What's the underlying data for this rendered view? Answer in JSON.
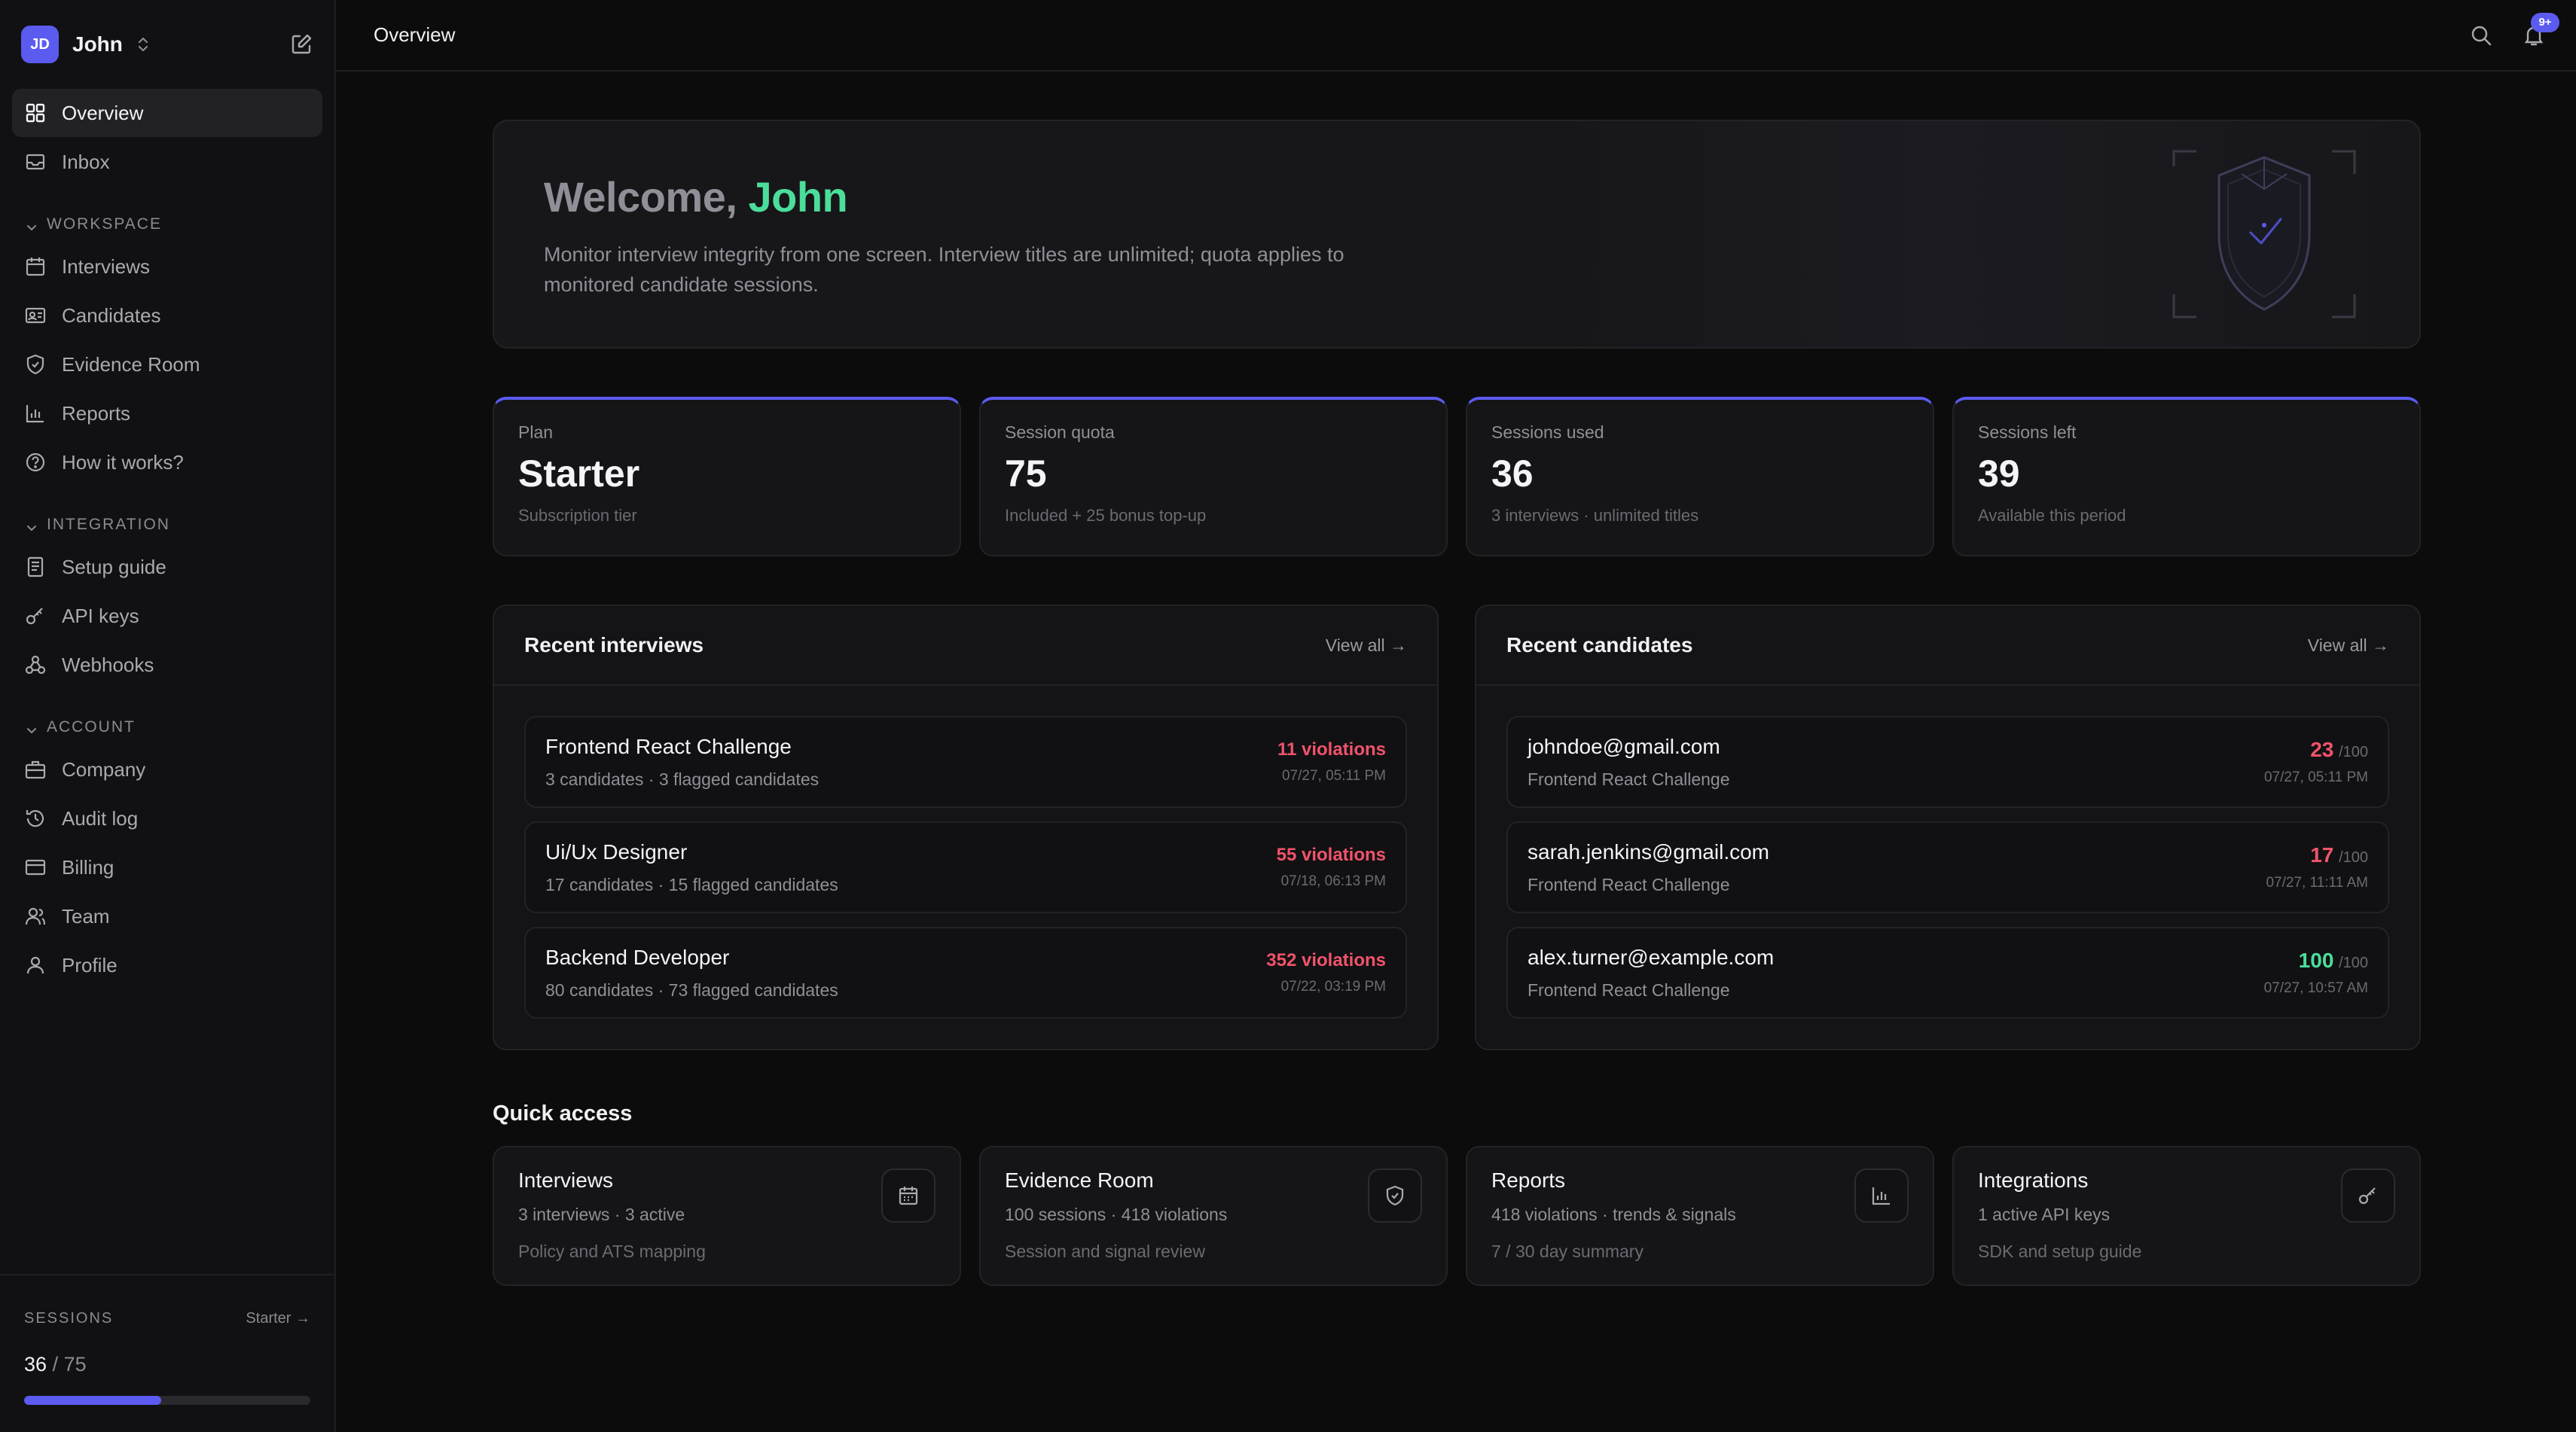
{
  "user": {
    "initials": "JD",
    "name": "John"
  },
  "nav": {
    "top": [
      {
        "label": "Overview",
        "icon": "grid-icon",
        "active": true
      },
      {
        "label": "Inbox",
        "icon": "inbox-icon"
      }
    ],
    "sections": [
      {
        "title": "WORKSPACE",
        "items": [
          {
            "label": "Interviews",
            "icon": "calendar-icon"
          },
          {
            "label": "Candidates",
            "icon": "id-card-icon"
          },
          {
            "label": "Evidence Room",
            "icon": "shield-icon"
          },
          {
            "label": "Reports",
            "icon": "bar-chart-icon"
          },
          {
            "label": "How it works?",
            "icon": "help-circle-icon"
          }
        ]
      },
      {
        "title": "INTEGRATION",
        "items": [
          {
            "label": "Setup guide",
            "icon": "document-icon"
          },
          {
            "label": "API keys",
            "icon": "key-icon"
          },
          {
            "label": "Webhooks",
            "icon": "webhook-icon"
          }
        ]
      },
      {
        "title": "ACCOUNT",
        "items": [
          {
            "label": "Company",
            "icon": "briefcase-icon"
          },
          {
            "label": "Audit log",
            "icon": "history-icon"
          },
          {
            "label": "Billing",
            "icon": "credit-card-icon"
          },
          {
            "label": "Team",
            "icon": "users-icon"
          },
          {
            "label": "Profile",
            "icon": "user-icon"
          }
        ]
      }
    ]
  },
  "sidebar_footer": {
    "label": "SESSIONS",
    "plan_link": "Starter →",
    "used": "36",
    "separator": "/",
    "total": "75",
    "progress_fraction": 0.48
  },
  "topbar": {
    "title": "Overview",
    "notification_badge": "9+"
  },
  "welcome": {
    "greeting": "Welcome,",
    "name": "John",
    "description": "Monitor interview integrity from one screen. Interview titles are unlimited; quota applies to monitored candidate sessions."
  },
  "stats": [
    {
      "label": "Plan",
      "value": "Starter",
      "sub": "Subscription tier"
    },
    {
      "label": "Session quota",
      "value": "75",
      "sub": "Included + 25 bonus top-up"
    },
    {
      "label": "Sessions used",
      "value": "36",
      "sub": "3 interviews · unlimited titles"
    },
    {
      "label": "Sessions left",
      "value": "39",
      "sub": "Available this period"
    }
  ],
  "recent_interviews": {
    "title": "Recent interviews",
    "view_all": "View all →",
    "rows": [
      {
        "title": "Frontend React Challenge",
        "sub": "3 candidates · 3 flagged candidates",
        "metric": "11 violations",
        "date": "07/27, 05:11 PM"
      },
      {
        "title": "Ui/Ux Designer",
        "sub": "17 candidates · 15 flagged candidates",
        "metric": "55 violations",
        "date": "07/18, 06:13 PM"
      },
      {
        "title": "Backend Developer",
        "sub": "80 candidates · 73 flagged candidates",
        "metric": "352 violations",
        "date": "07/22, 03:19 PM"
      }
    ]
  },
  "recent_candidates": {
    "title": "Recent candidates",
    "view_all": "View all →",
    "rows": [
      {
        "email": "johndoe@gmail.com",
        "interview": "Frontend React Challenge",
        "score": "23",
        "max": "/100",
        "date": "07/27, 05:11 PM"
      },
      {
        "email": "sarah.jenkins@gmail.com",
        "interview": "Frontend React Challenge",
        "score": "17",
        "max": "/100",
        "date": "07/27, 11:11 AM"
      },
      {
        "email": "alex.turner@example.com",
        "interview": "Frontend React Challenge",
        "score": "100",
        "max": "/100",
        "date": "07/27, 10:57 AM"
      }
    ]
  },
  "quick_access": {
    "title": "Quick access",
    "cards": [
      {
        "name": "Interviews",
        "line1": "3 interviews · 3 active",
        "line2": "Policy and ATS mapping",
        "icon": "calendar-icon"
      },
      {
        "name": "Evidence Room",
        "line1": "100 sessions · 418 violations",
        "line2": "Session and signal review",
        "icon": "shield-check-icon"
      },
      {
        "name": "Reports",
        "line1": "418 violations · trends & signals",
        "line2": "7 / 30 day summary",
        "icon": "bar-chart-icon"
      },
      {
        "name": "Integrations",
        "line1": "1 active API keys",
        "line2": "SDK and setup guide",
        "icon": "key-icon"
      }
    ]
  },
  "colors": {
    "accent": "#5b5bf0",
    "positive": "#4ade9a",
    "negative": "#f0536b",
    "background": "#0c0c0d"
  }
}
